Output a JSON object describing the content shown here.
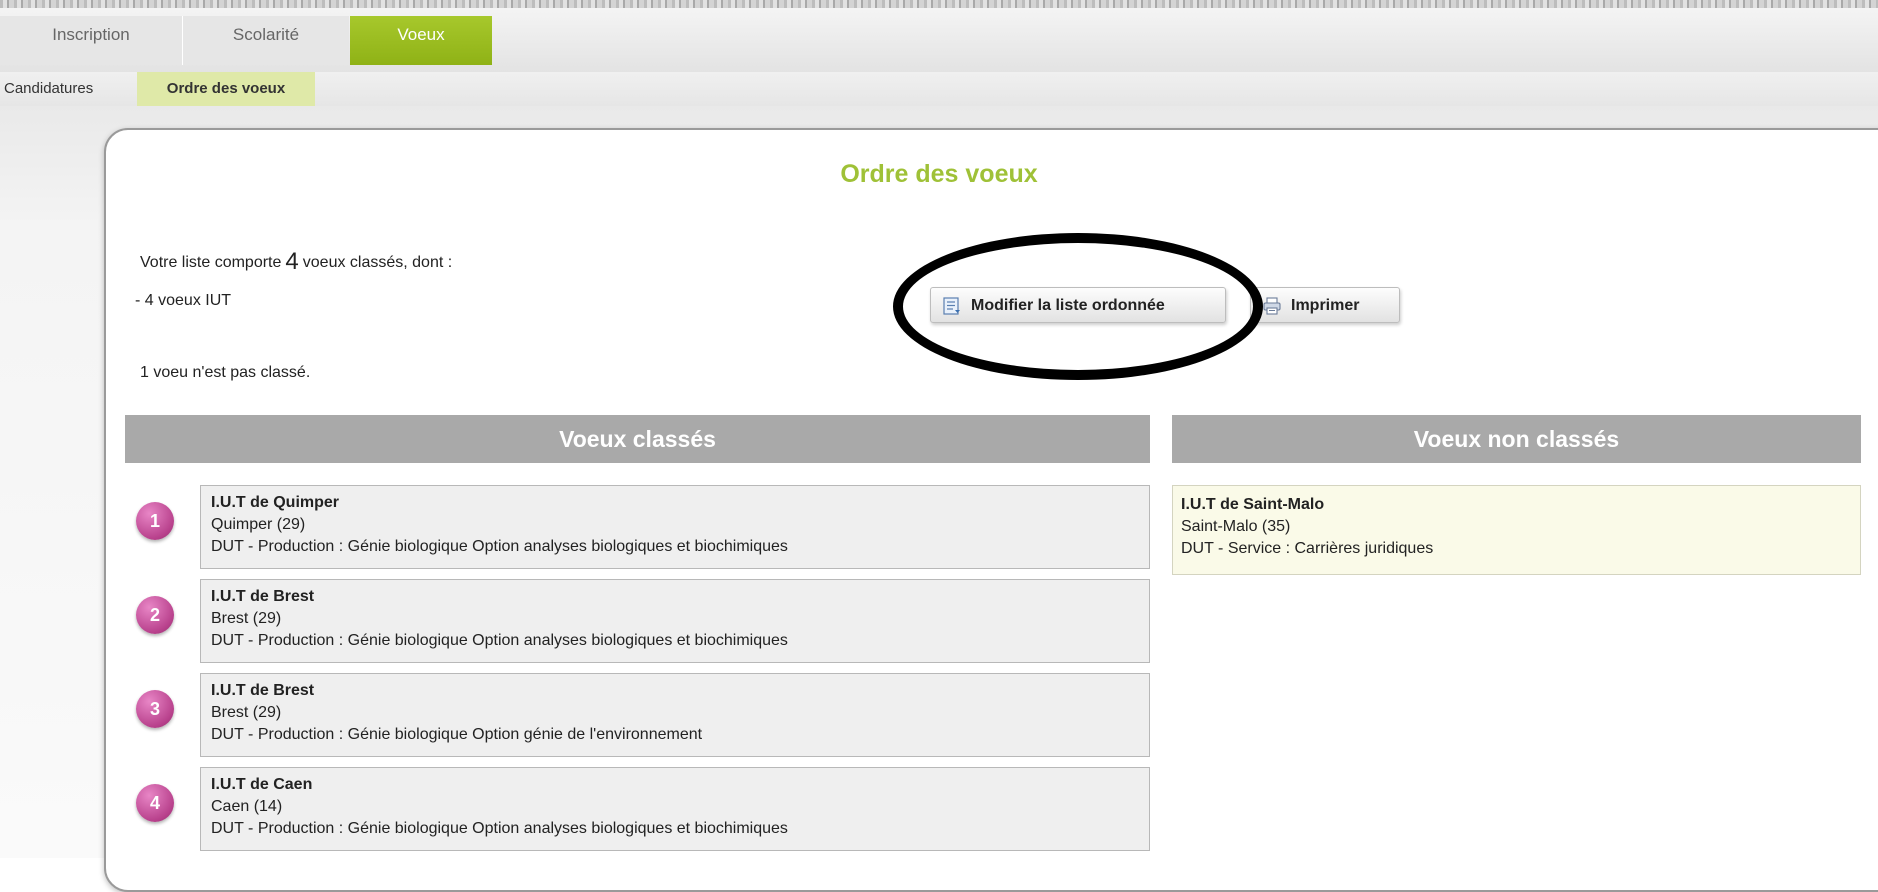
{
  "nav": {
    "tabs": [
      {
        "label": "Inscription"
      },
      {
        "label": "Scolarité"
      },
      {
        "label": "Voeux"
      }
    ],
    "subtabs": [
      {
        "label": "Candidatures"
      },
      {
        "label": "Ordre des voeux"
      }
    ],
    "accent_color": "#9fc137"
  },
  "page": {
    "title": "Ordre des voeux",
    "summary_prefix": "Votre liste comporte",
    "summary_count": "4",
    "summary_suffix": "voeux classés, dont :",
    "iut_line": "- 4 voeux IUT",
    "unranked_note": "1 voeu n'est pas classé."
  },
  "buttons": {
    "modify_label": "Modifier la liste ordonnée",
    "modify_icon": "list-edit-icon",
    "print_label": "Imprimer",
    "print_icon": "printer-icon"
  },
  "ranked": {
    "header": "Voeux classés",
    "items": [
      {
        "rank": "1",
        "name": "I.U.T de Quimper",
        "city": "Quimper (29)",
        "program": "DUT - Production : Génie biologique Option analyses biologiques et biochimiques"
      },
      {
        "rank": "2",
        "name": "I.U.T de Brest",
        "city": "Brest (29)",
        "program": "DUT - Production : Génie biologique Option analyses biologiques et biochimiques"
      },
      {
        "rank": "3",
        "name": "I.U.T de Brest",
        "city": "Brest (29)",
        "program": "DUT - Production : Génie biologique Option génie de l'environnement"
      },
      {
        "rank": "4",
        "name": "I.U.T de Caen",
        "city": "Caen (14)",
        "program": "DUT - Production : Génie biologique Option analyses biologiques et biochimiques"
      }
    ]
  },
  "unranked": {
    "header": "Voeux non classés",
    "items": [
      {
        "name": "I.U.T de Saint-Malo",
        "city": "Saint-Malo (35)",
        "program": "DUT - Service : Carrières juridiques"
      }
    ]
  }
}
